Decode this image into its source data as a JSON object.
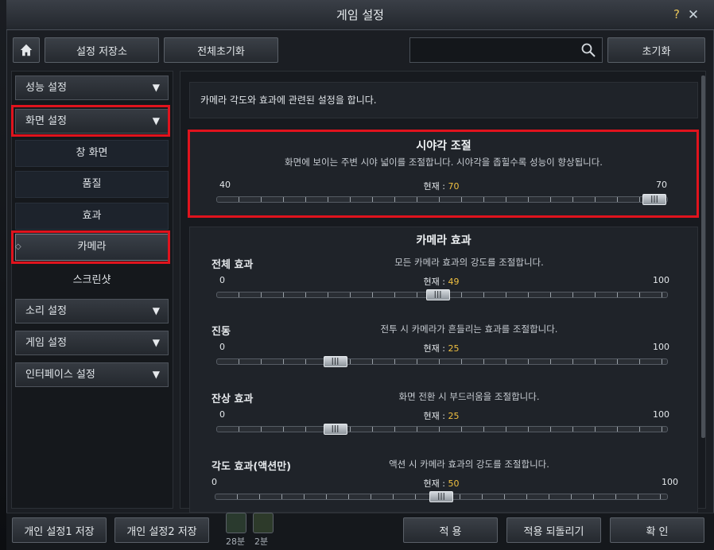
{
  "window": {
    "title": "게임 설정",
    "help": "?",
    "close": "✕"
  },
  "toolbar": {
    "save_store": "설정 저장소",
    "reset_all": "전체초기화",
    "search_value": "",
    "search_icon": "search-icon",
    "reset": "초기화"
  },
  "sidebar": {
    "perf": "성능 설정",
    "screen": "화면 설정",
    "sub": [
      "창 화면",
      "품질",
      "효과",
      "카메라",
      "스크린샷"
    ],
    "sound": "소리 설정",
    "game": "게임 설정",
    "ui": "인터페이스 설정"
  },
  "main": {
    "description": "카메라 각도와 효과에 관련된 설정을 합니다.",
    "fov": {
      "title": "시야각 조절",
      "desc": "화면에 보이는 주변 시야 넓이를 조절합니다. 시야각을 좁힐수록 성능이 향상됩니다.",
      "min": "40",
      "max": "70",
      "current_label": "현재 :",
      "current": "70",
      "value": 70
    },
    "camera_effect": {
      "title": "카메라 효과",
      "items": [
        {
          "label": "전체 효과",
          "desc": "모든 카메라 효과의 강도를 조절합니다.",
          "min": "0",
          "max": "100",
          "current_label": "현재 :",
          "current": "49",
          "value": 49
        },
        {
          "label": "진동",
          "desc": "전투 시 카메라가 흔들리는 효과를 조절합니다.",
          "min": "0",
          "max": "100",
          "current_label": "현재 :",
          "current": "25",
          "value": 25
        },
        {
          "label": "잔상 효과",
          "desc": "화면 전환 시 부드러움을 조절합니다.",
          "min": "0",
          "max": "100",
          "current_label": "현재 :",
          "current": "25",
          "value": 25
        },
        {
          "label": "각도 효과(액션만)",
          "desc": "액션 시 카메라 효과의 강도를 조절합니다.",
          "min": "0",
          "max": "100",
          "current_label": "현재 :",
          "current": "50",
          "value": 50
        }
      ]
    },
    "thumb_glyph": "|||"
  },
  "footer": {
    "personal1": "개인 설정1 저장",
    "personal2": "개인 설정2 저장",
    "hud1": "28분",
    "hud2": "2분",
    "apply": "적 용",
    "revert": "적용 되돌리기",
    "ok": "확 인"
  },
  "colors": {
    "highlight": "#e0131d",
    "current_value": "#f0c040"
  }
}
